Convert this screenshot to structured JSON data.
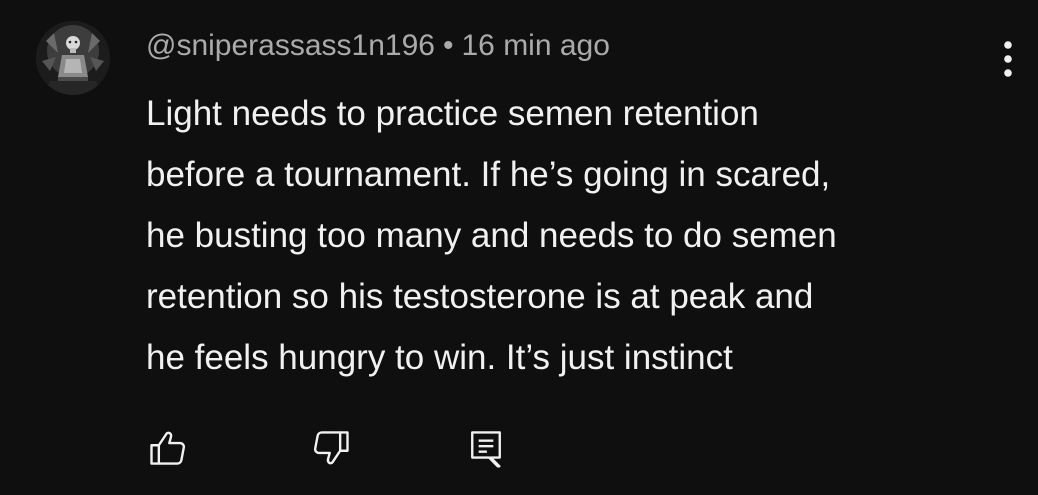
{
  "comment": {
    "author": "@sniperassass1n196",
    "separator": "•",
    "timestamp": "16 min ago",
    "text_lines": [
      "Light needs to practice semen retention",
      "before a tournament. If he’s going in scared,",
      "he busting too many and needs to do semen",
      "retention so his testosterone is at peak and",
      "he feels hungry to win. It’s just instinct"
    ]
  },
  "actions": {
    "like_icon": "thumbs-up-icon",
    "dislike_icon": "thumbs-down-icon",
    "reply_icon": "reply-comment-icon",
    "more_icon": "more-vertical-icon"
  },
  "colors": {
    "background": "#0f0f0f",
    "primary_text": "#f1f1f1",
    "secondary_text": "#aaaaaa"
  }
}
